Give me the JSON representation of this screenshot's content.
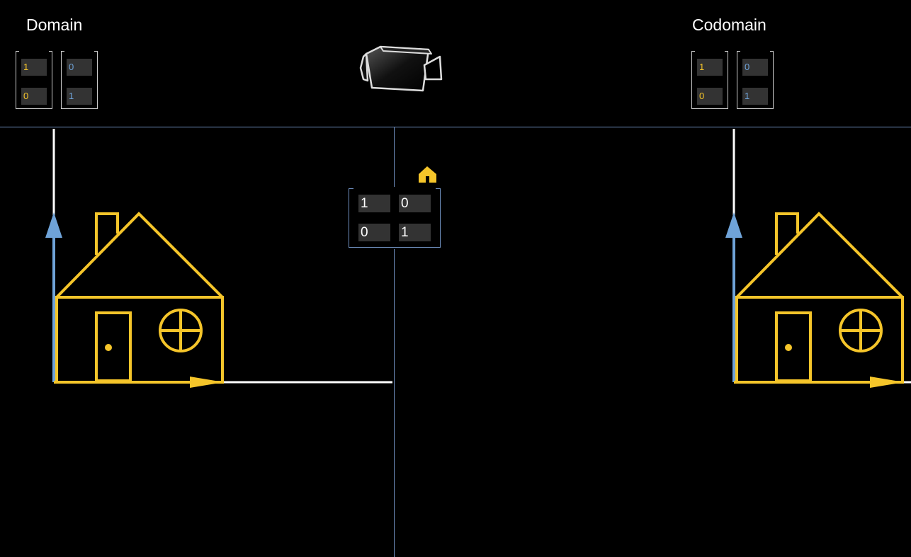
{
  "domain": {
    "title": "Domain",
    "basis_x": [
      "1",
      "0"
    ],
    "basis_y": [
      "0",
      "1"
    ]
  },
  "codomain": {
    "title": "Codomain",
    "basis_x": [
      "1",
      "0"
    ],
    "basis_y": [
      "0",
      "1"
    ]
  },
  "transform_matrix": {
    "row1": [
      "1",
      "0"
    ],
    "row2": [
      "0",
      "1"
    ]
  },
  "colors": {
    "house": "#f5c52a",
    "x_basis": "#f5c52a",
    "y_basis": "#6fa3d8",
    "axis": "#ffffff",
    "divider": "#6f8fbf"
  },
  "icons": {
    "camera": "video-camera-icon",
    "home": "home-icon"
  }
}
